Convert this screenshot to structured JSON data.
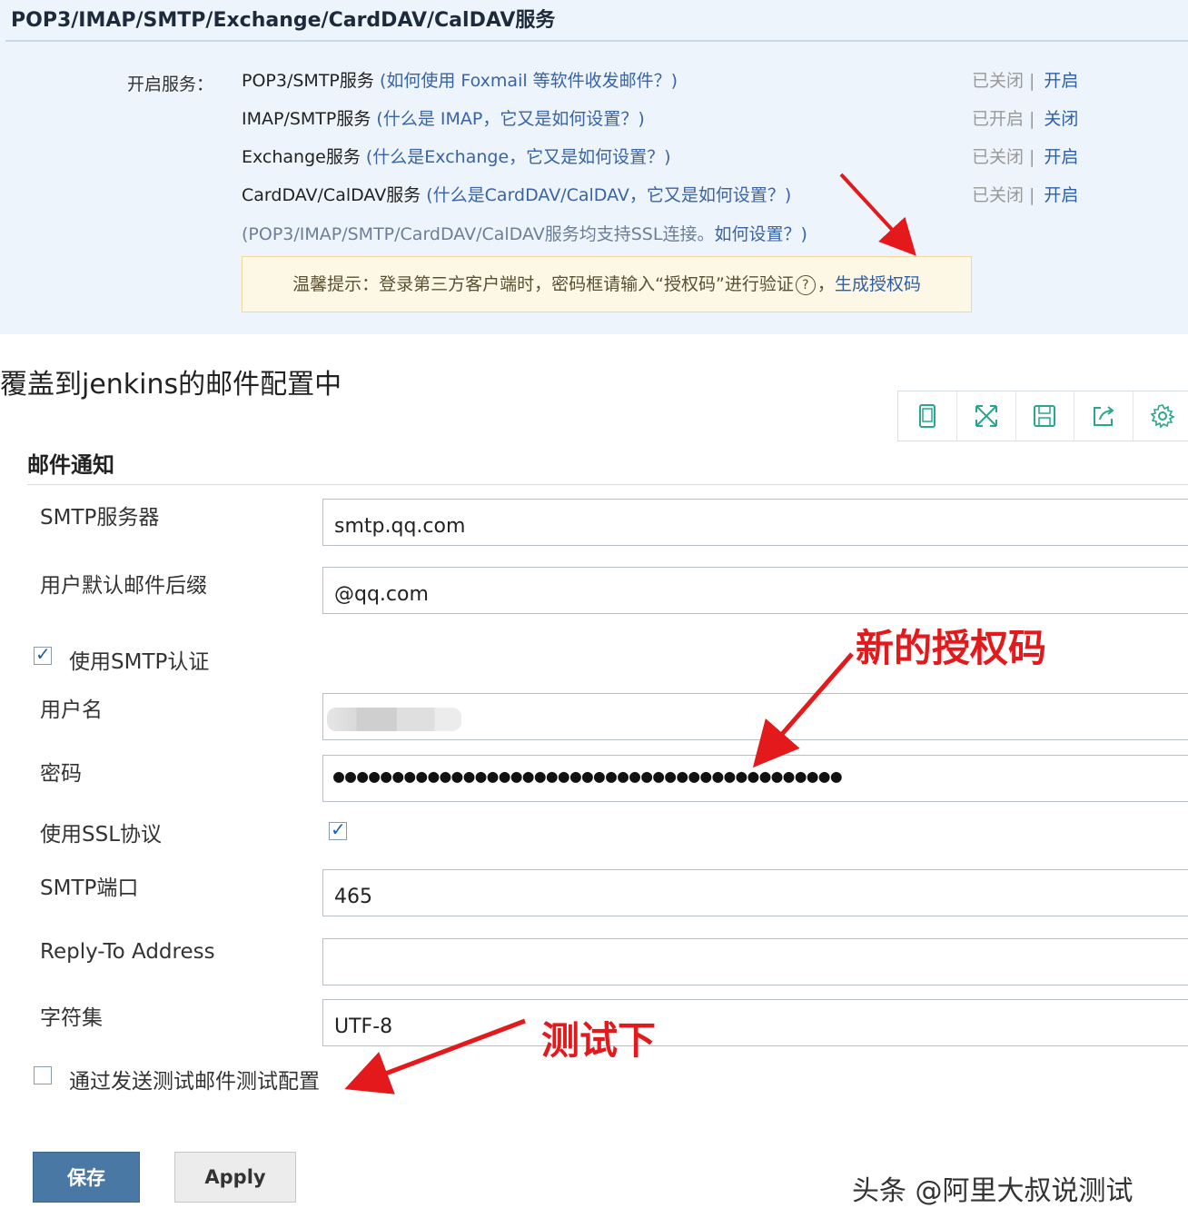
{
  "qq_mail": {
    "title": "POP3/IMAP/SMTP/Exchange/CardDAV/CalDAV服务",
    "enable_label": "开启服务：",
    "services": [
      {
        "name": "POP3/SMTP服务",
        "help": "(如何使用 Foxmail 等软件收发邮件？)",
        "status": "已关闭",
        "action": "开启"
      },
      {
        "name": "IMAP/SMTP服务",
        "help": "(什么是 IMAP，它又是如何设置？)",
        "status": "已开启",
        "action": "关闭"
      },
      {
        "name": "Exchange服务",
        "help": "(什么是Exchange，它又是如何设置？)",
        "status": "已关闭",
        "action": "开启"
      },
      {
        "name": "CardDAV/CalDAV服务",
        "help": "(什么是CardDAV/CalDAV，它又是如何设置？)",
        "status": "已关闭",
        "action": "开启"
      }
    ],
    "ssl_note": "(POP3/IMAP/SMTP/CardDAV/CalDAV服务均支持SSL连接。",
    "ssl_help": "如何设置？)",
    "tip_text": "温馨提示：登录第三方客户端时，密码框请输入“授权码”进行验证",
    "tip_help_icon": "?",
    "tip_link": "生成授权码"
  },
  "heading": "覆盖到jenkins的邮件配置中",
  "toolbar": {
    "icons": [
      "tablet-icon",
      "expand-icon",
      "save-disk-icon",
      "share-icon",
      "settings-gear-icon"
    ]
  },
  "form": {
    "section_title": "邮件通知",
    "smtp_server_label": "SMTP服务器",
    "smtp_server_value": "smtp.qq.com",
    "suffix_label": "用户默认邮件后缀",
    "suffix_value": "@qq.com",
    "use_smtp_auth_label": "使用SMTP认证",
    "use_smtp_auth_checked": true,
    "username_label": "用户名",
    "password_label": "密码",
    "password_mask": "●●●●●●●●●●●●●●●●●●●●●●●●●●●●●●●●●●●●●●●●●●●",
    "use_ssl_label": "使用SSL协议",
    "use_ssl_checked": true,
    "smtp_port_label": "SMTP端口",
    "smtp_port_value": "465",
    "reply_to_label": "Reply-To Address",
    "reply_to_value": "",
    "charset_label": "字符集",
    "charset_value": "UTF-8",
    "test_config_label": "通过发送测试邮件测试配置",
    "test_config_checked": false
  },
  "buttons": {
    "save": "保存",
    "apply": "Apply"
  },
  "annotations": {
    "new_auth_code": "新的授权码",
    "test_it": "测试下",
    "color": "#e3191c"
  },
  "watermark": "头条 @阿里大叔说测试"
}
